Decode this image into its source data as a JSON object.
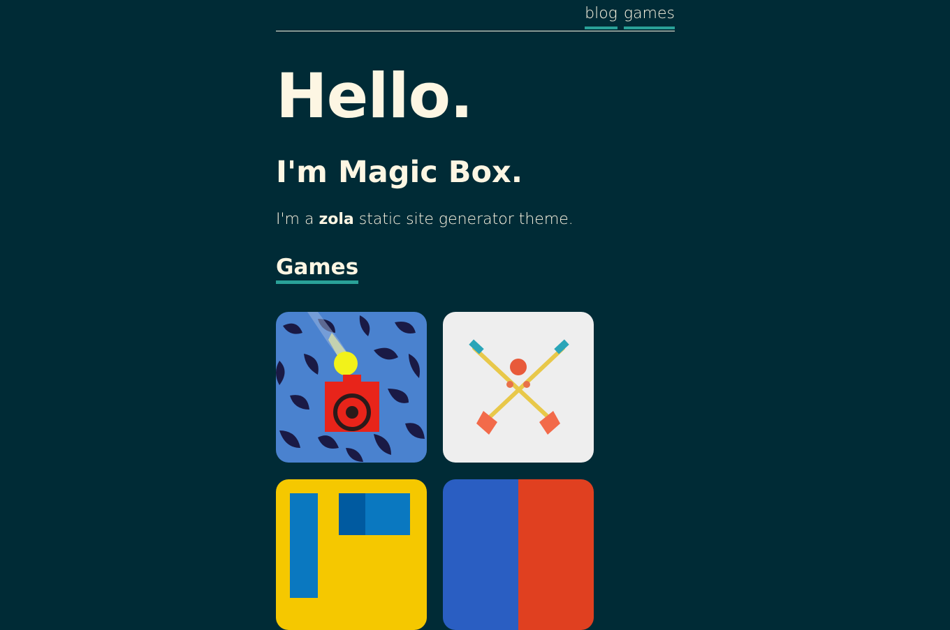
{
  "nav": {
    "items": [
      {
        "label": "blog"
      },
      {
        "label": "games"
      }
    ]
  },
  "hero": {
    "title": "Hello.",
    "subtitle": "I'm Magic Box.",
    "intro_prefix": "I'm a ",
    "intro_bold": "zola",
    "intro_suffix": " static site generator theme."
  },
  "games": {
    "heading": "Games",
    "tiles": [
      {
        "icon": "ball-cannon-icon"
      },
      {
        "icon": "crossed-brooms-icon"
      },
      {
        "icon": "maze-blocks-icon"
      },
      {
        "icon": "split-color-icon"
      }
    ]
  },
  "colors": {
    "background": "#002b36",
    "text": "#fdf6e3",
    "accent": "#2aa198"
  }
}
